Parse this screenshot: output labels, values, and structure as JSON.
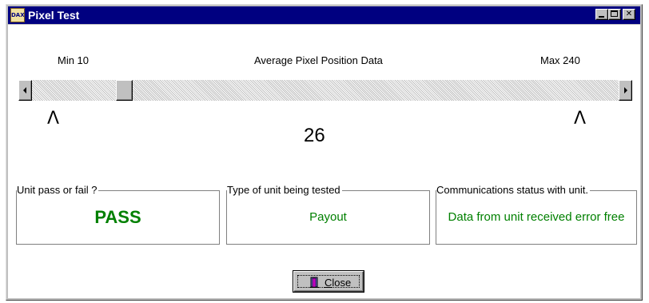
{
  "window": {
    "title": "Pixel Test",
    "icon_text": "DAX",
    "icon": "app-icon",
    "controls": [
      "minimize-icon",
      "maximize-icon",
      "close-icon"
    ],
    "close_glyph": "✕"
  },
  "slider": {
    "min_label": "Min 10",
    "title_label": "Average Pixel Position Data",
    "max_label": "Max 240",
    "min": 10,
    "max": 240,
    "value": 26,
    "value_text": "26",
    "left_marker": "Λ",
    "right_marker": "Λ"
  },
  "groups": {
    "pass_fail": {
      "label": "Unit pass or fail ?",
      "value": "PASS"
    },
    "unit_type": {
      "label": "Type of unit being tested",
      "value": "Payout"
    },
    "comm_status": {
      "label": "Communications status with unit.",
      "value": "Data from unit received error free"
    }
  },
  "close_button": {
    "label_first": "C",
    "label_rest": "lose",
    "icon": "door-exit-icon"
  },
  "colors": {
    "titlebar": "#000080",
    "status_text": "#008000",
    "face": "#c0c0c0"
  }
}
